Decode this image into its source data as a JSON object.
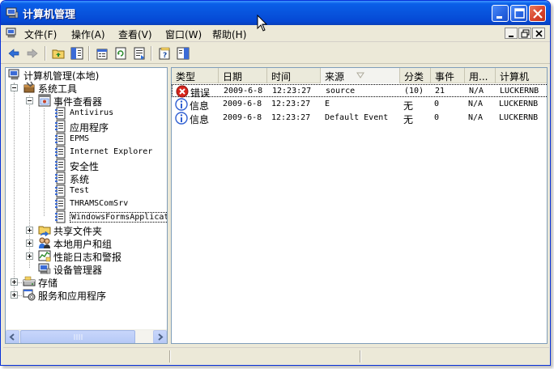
{
  "window": {
    "title": "计算机管理",
    "controls": [
      "minimize",
      "maximize",
      "close"
    ]
  },
  "menu": {
    "items": [
      "文件(F)",
      "操作(A)",
      "查看(V)",
      "窗口(W)",
      "帮助(H)"
    ]
  },
  "toolbar": {
    "buttons": [
      "back-icon",
      "forward-icon",
      "up-folder-icon",
      "show-hide-tree-icon",
      "properties-icon",
      "refresh-icon",
      "export-list-icon",
      "help-icon",
      "show-action-pane-icon"
    ]
  },
  "tree": {
    "root": "计算机管理(本地)",
    "system_tools": "系统工具",
    "event_viewer": "事件查看器",
    "logs": [
      "Antivirus",
      "应用程序",
      "EPMS",
      "Internet Explorer",
      "安全性",
      "系统",
      "Test",
      "THRAMSComSrv",
      "WindowsFormsApplicati"
    ],
    "shared_folders": "共享文件夹",
    "local_users": "本地用户和组",
    "perf_logs": "性能日志和警报",
    "device_manager": "设备管理器",
    "storage": "存储",
    "services_apps": "服务和应用程序"
  },
  "list": {
    "columns": [
      "类型",
      "日期",
      "时间",
      "来源",
      "分类",
      "事件",
      "用...",
      "计算机"
    ],
    "sorted_column": "来源",
    "rows": [
      {
        "icon": "error-icon",
        "type": "错误",
        "date": "2009-6-8",
        "time": "12:23:27",
        "source": "source",
        "category": "(10)",
        "event": "21",
        "user": "N/A",
        "computer": "LUCKERNB"
      },
      {
        "icon": "info-icon",
        "type": "信息",
        "date": "2009-6-8",
        "time": "12:23:27",
        "source": "E",
        "category": "无",
        "event": "0",
        "user": "N/A",
        "computer": "LUCKERNB"
      },
      {
        "icon": "info-icon",
        "type": "信息",
        "date": "2009-6-8",
        "time": "12:23:27",
        "source": "Default Event",
        "category": "无",
        "event": "0",
        "user": "N/A",
        "computer": "LUCKERNB"
      }
    ]
  },
  "colors": {
    "title_bar": "#0854dd",
    "window_bg": "#ece9d8",
    "error": "#d6241b",
    "info": "#2f5fd2"
  }
}
